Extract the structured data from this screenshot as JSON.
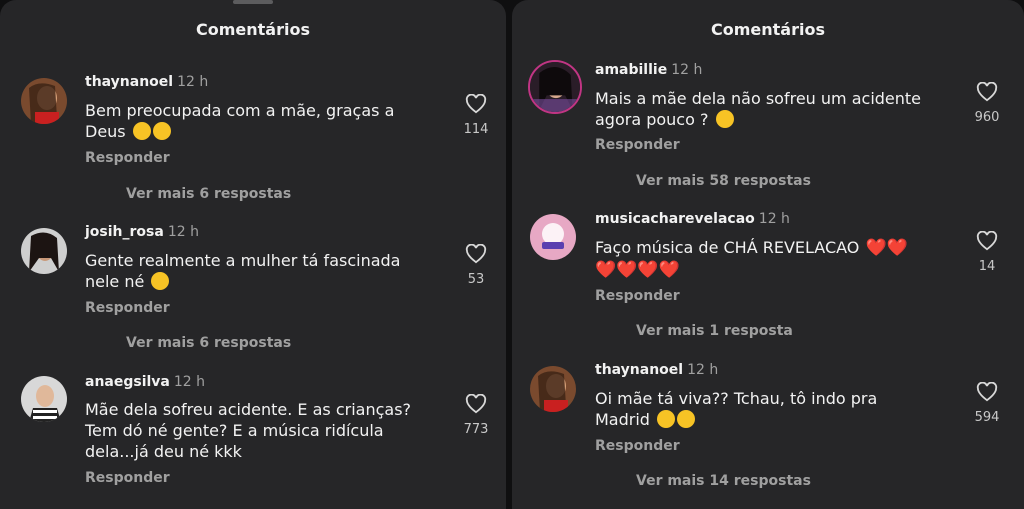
{
  "left": {
    "title": "Comentários",
    "comments": [
      {
        "user": "thaynanoel",
        "time": "12 h",
        "text_line1": "Bem preocupada com a mãe, graças a",
        "text_line2": "Deus",
        "likes": "114",
        "reply": "Responder",
        "more": "Ver mais 6 respostas"
      },
      {
        "user": "josih_rosa",
        "time": "12 h",
        "text_line1": "Gente realmente a mulher tá fascinada",
        "text_line2": "nele né",
        "likes": "53",
        "reply": "Responder",
        "more": "Ver mais 6 respostas"
      },
      {
        "user": "anaegsilva",
        "time": "12 h",
        "text_line1": "Mãe dela sofreu acidente. E as crianças?",
        "text_line2": "Tem dó né gente? E a música ridícula",
        "text_line3": "dela...já deu né kkk",
        "likes": "773",
        "reply": "Responder"
      }
    ]
  },
  "right": {
    "title": "Comentários",
    "comments": [
      {
        "user": "amabillie",
        "time": "12 h",
        "text_line1": "Mais a mãe dela não sofreu um acidente",
        "text_line2": "agora pouco ?",
        "likes": "960",
        "reply": "Responder",
        "more": "Ver mais 58 respostas"
      },
      {
        "user": "musicacharevelacao",
        "time": "12 h",
        "text_line1": "Faço música de CHÁ REVELACAO",
        "hearts_line1": "❤️❤️",
        "hearts_line2": "❤️❤️❤️❤️",
        "likes": "14",
        "reply": "Responder",
        "more": "Ver mais 1 resposta"
      },
      {
        "user": "thaynanoel",
        "time": "12 h",
        "text_line1": "Oi mãe tá viva?? Tchau, tô indo pra",
        "text_line2": "Madrid",
        "likes": "594",
        "reply": "Responder",
        "more": "Ver mais 14 respostas"
      }
    ]
  },
  "icons": {
    "like": "heart-outline-icon"
  },
  "colors": {
    "panel": "#262628",
    "muted": "#a0a0a0",
    "text": "#f2f2f2"
  }
}
